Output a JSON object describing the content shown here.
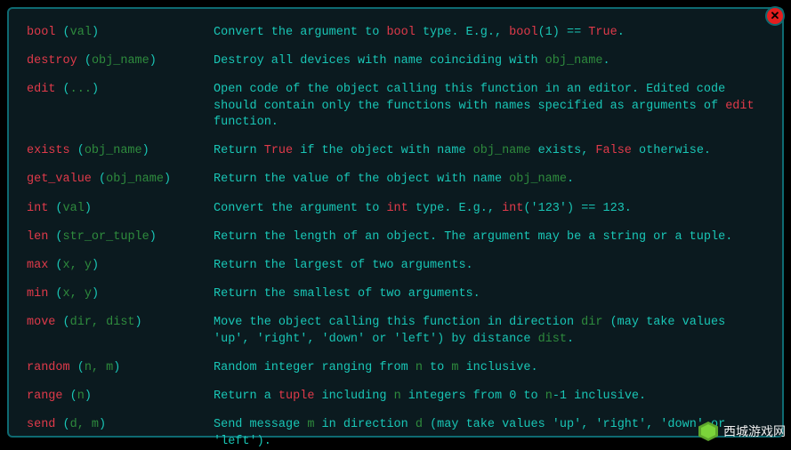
{
  "close_label": "✕",
  "watermark": "西城游戏网",
  "entries": [
    {
      "name": "bool",
      "param": "val",
      "desc": [
        {
          "t": "Convert the argument to "
        },
        {
          "t": "bool",
          "c": "kw"
        },
        {
          "t": " type. E.g., "
        },
        {
          "t": "bool",
          "c": "kw"
        },
        {
          "t": "(1) == "
        },
        {
          "t": "True",
          "c": "kw"
        },
        {
          "t": "."
        }
      ]
    },
    {
      "name": "destroy",
      "param": "obj_name",
      "desc": [
        {
          "t": "Destroy all devices with name coinciding with "
        },
        {
          "t": "obj_name",
          "c": "hi"
        },
        {
          "t": "."
        }
      ]
    },
    {
      "name": "edit",
      "param": "...",
      "desc": [
        {
          "t": "Open code of the object calling this function in an editor. Edited code should contain only the functions with names specified as arguments of "
        },
        {
          "t": "edit",
          "c": "kw"
        },
        {
          "t": " function."
        }
      ]
    },
    {
      "name": "exists",
      "param": "obj_name",
      "desc": [
        {
          "t": "Return "
        },
        {
          "t": "True",
          "c": "kw"
        },
        {
          "t": " if the object with name "
        },
        {
          "t": "obj_name",
          "c": "hi"
        },
        {
          "t": " exists, "
        },
        {
          "t": "False",
          "c": "kw"
        },
        {
          "t": " otherwise."
        }
      ]
    },
    {
      "name": "get_value",
      "param": "obj_name",
      "desc": [
        {
          "t": "Return the value of the object with name "
        },
        {
          "t": "obj_name",
          "c": "hi"
        },
        {
          "t": "."
        }
      ]
    },
    {
      "name": "int",
      "param": "val",
      "desc": [
        {
          "t": "Convert the argument to "
        },
        {
          "t": "int",
          "c": "kw"
        },
        {
          "t": " type. E.g., "
        },
        {
          "t": "int",
          "c": "kw"
        },
        {
          "t": "('123') == 123."
        }
      ]
    },
    {
      "name": "len",
      "param": "str_or_tuple",
      "desc": [
        {
          "t": "Return the length of an object. The argument may be a string or a tuple."
        }
      ]
    },
    {
      "name": "max",
      "param": "x, y",
      "desc": [
        {
          "t": "Return the largest of two arguments."
        }
      ]
    },
    {
      "name": "min",
      "param": "x, y",
      "desc": [
        {
          "t": "Return the smallest of two arguments."
        }
      ]
    },
    {
      "name": "move",
      "param": "dir, dist",
      "desc": [
        {
          "t": "Move the object calling this function in direction "
        },
        {
          "t": "dir",
          "c": "hi"
        },
        {
          "t": " (may take values 'up', 'right', 'down' or 'left') by distance "
        },
        {
          "t": "dist",
          "c": "hi"
        },
        {
          "t": "."
        }
      ]
    },
    {
      "name": "random",
      "param": "n, m",
      "desc": [
        {
          "t": "Random integer ranging from "
        },
        {
          "t": "n",
          "c": "hi"
        },
        {
          "t": " to "
        },
        {
          "t": "m",
          "c": "hi"
        },
        {
          "t": " inclusive."
        }
      ]
    },
    {
      "name": "range",
      "param": "n",
      "desc": [
        {
          "t": "Return a "
        },
        {
          "t": "tuple",
          "c": "kw"
        },
        {
          "t": " including "
        },
        {
          "t": "n",
          "c": "hi"
        },
        {
          "t": " integers from 0 to "
        },
        {
          "t": "n",
          "c": "hi"
        },
        {
          "t": "-1 inclusive."
        }
      ]
    },
    {
      "name": "send",
      "param": "d, m",
      "desc": [
        {
          "t": "Send message "
        },
        {
          "t": "m",
          "c": "hi"
        },
        {
          "t": " in direction "
        },
        {
          "t": "d",
          "c": "hi"
        },
        {
          "t": " (may take values 'up', 'right', 'down' or 'left')."
        }
      ]
    }
  ]
}
